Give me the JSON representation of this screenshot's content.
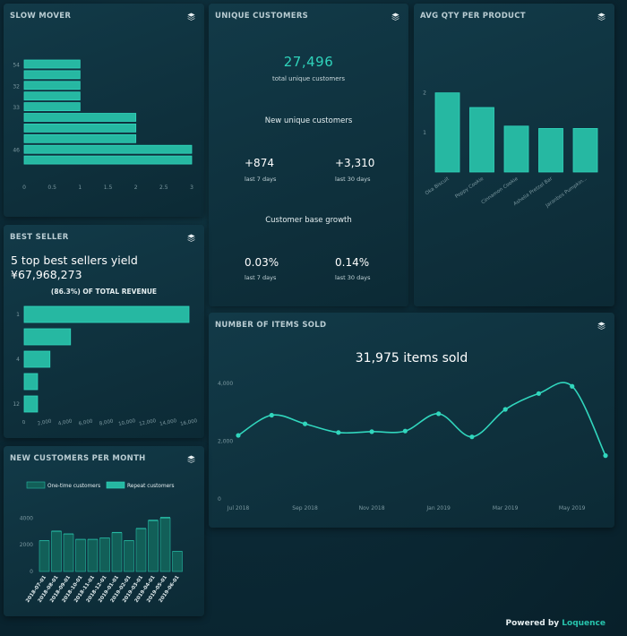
{
  "cards": {
    "slow_mover": {
      "title": "SLOW MOVER"
    },
    "unique_customers": {
      "title": "UNIQUE CUSTOMERS"
    },
    "avg_qty": {
      "title": "AVG QTY PER PRODUCT"
    },
    "best_seller": {
      "title": "BEST SELLER"
    },
    "items_sold": {
      "title": "NUMBER OF ITEMS SOLD"
    },
    "new_customers": {
      "title": "NEW CUSTOMERS PER MONTH"
    }
  },
  "unique": {
    "total": "27,496",
    "total_caption": "total unique customers",
    "new_heading": "New unique customers",
    "new_7": "+874",
    "new_7_caption": "last 7 days",
    "new_30": "+3,310",
    "new_30_caption": "last 30 days",
    "growth_heading": "Customer base growth",
    "growth_7": "0.03%",
    "growth_7_caption": "last 7 days",
    "growth_30": "0.14%",
    "growth_30_caption": "last 30 days"
  },
  "best_seller": {
    "headline": "5 top best sellers yield",
    "amount": "¥67,968,273",
    "share": "(86.3%) OF TOTAL REVENUE"
  },
  "items_sold": {
    "headline": "31,975 items sold"
  },
  "footer": {
    "powered_by": "Powered by",
    "brand": "Loquence"
  },
  "colors": {
    "accent": "#26b8a2",
    "accent_light": "#31d6bd",
    "bar_dark": "#125f58",
    "text_muted": "#7b98a0"
  },
  "chart_data": [
    {
      "id": "slow_mover",
      "type": "bar",
      "orientation": "horizontal",
      "categories": [
        "54",
        "",
        "32",
        "",
        "33",
        "",
        "",
        "",
        "46",
        ""
      ],
      "values": [
        1,
        1,
        1,
        1,
        1,
        2,
        2,
        2,
        3,
        3
      ],
      "x_ticks": [
        "0",
        "0.5",
        "1",
        "1.5",
        "2",
        "2.5",
        "3"
      ],
      "xlim": [
        0,
        3
      ]
    },
    {
      "id": "avg_qty",
      "type": "bar",
      "categories": [
        "Oka Biscuit",
        "Poppy Cookie",
        "Cinnamon Cookie",
        "Ashelia Pretzel Bar",
        "Jaranbes Pumpkin..."
      ],
      "values": [
        2.0,
        1.63,
        1.16,
        1.1,
        1.1
      ],
      "y_ticks": [
        "1",
        "2"
      ],
      "ylim": [
        0,
        2.4
      ]
    },
    {
      "id": "best_seller",
      "type": "bar",
      "orientation": "horizontal",
      "categories": [
        "1",
        "",
        "4",
        "",
        "12"
      ],
      "values": [
        16000,
        4500,
        2500,
        1300,
        1300
      ],
      "x_ticks": [
        "0",
        "2,000",
        "4,000",
        "6,000",
        "8,000",
        "10,000",
        "12,000",
        "14,000",
        "16,000"
      ],
      "xlim": [
        0,
        16000
      ]
    },
    {
      "id": "items_sold",
      "type": "line",
      "x": [
        "2018-07",
        "2018-08",
        "2018-09",
        "2018-10",
        "2018-11",
        "2018-12",
        "2019-01",
        "2019-02",
        "2019-03",
        "2019-04",
        "2019-05",
        "2019-06"
      ],
      "values": [
        2200,
        2900,
        2600,
        2300,
        2330,
        2350,
        2950,
        2150,
        3100,
        3650,
        3900,
        1500
      ],
      "x_ticks": [
        "Jul 2018",
        "Sep 2018",
        "Nov 2018",
        "Jan 2019",
        "Mar 2019",
        "May 2019"
      ],
      "y_ticks": [
        "0",
        "2,000",
        "4,000"
      ],
      "ylim": [
        0,
        4000
      ]
    },
    {
      "id": "new_customers",
      "type": "bar",
      "stacked": true,
      "categories": [
        "2018-07-01",
        "2018-08-01",
        "2018-09-01",
        "2018-10-01",
        "2018-11-01",
        "2018-12-01",
        "2019-01-01",
        "2019-02-01",
        "2019-03-01",
        "2019-04-01",
        "2019-05-01",
        "2019-06-01"
      ],
      "series": [
        {
          "name": "One-time customers",
          "values": [
            2300,
            3000,
            2800,
            2400,
            2400,
            2500,
            2900,
            2300,
            3200,
            3800,
            4000,
            1500
          ]
        },
        {
          "name": "Repeat customers",
          "values": [
            40,
            60,
            50,
            40,
            40,
            40,
            60,
            40,
            60,
            80,
            90,
            30
          ]
        }
      ],
      "y_ticks": [
        "0",
        "2000",
        "4000"
      ],
      "ylim": [
        0,
        4700
      ]
    }
  ]
}
